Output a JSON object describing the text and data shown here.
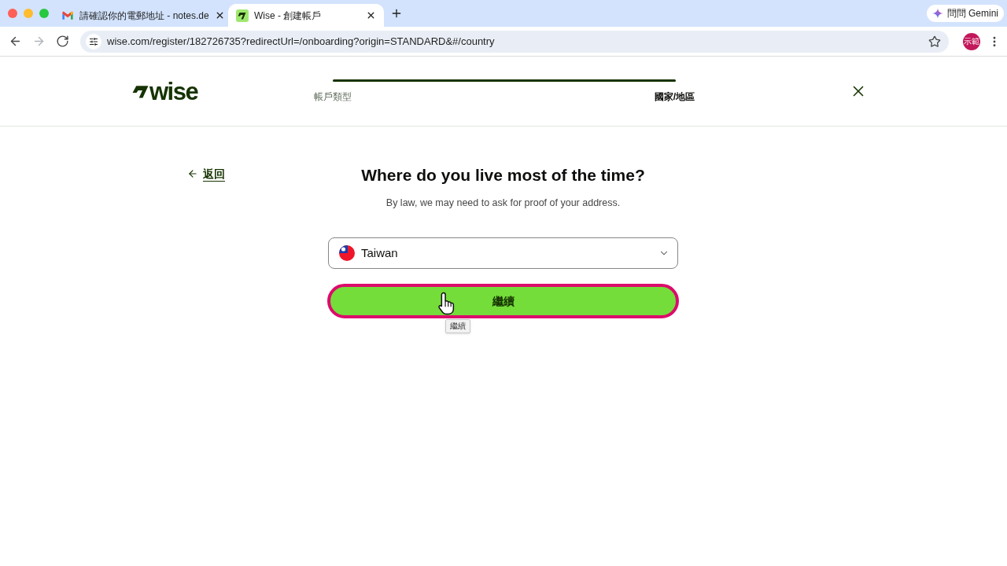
{
  "browser": {
    "tabs": [
      {
        "title": "請確認你的電郵地址 - notes.de",
        "kind": "mail",
        "selected": false
      },
      {
        "title": "Wise - 創建帳戶",
        "kind": "logo",
        "selected": true
      }
    ],
    "gemini_button": "問問 Gemini",
    "nav_buttons": [
      {
        "kind": "back",
        "disabled": false
      },
      {
        "kind": "forward",
        "disabled": true
      },
      {
        "kind": "reload",
        "disabled": false
      }
    ],
    "address": "wise.com/register/182726735?redirectUrl=/onboarding?origin=STANDARD&#/country",
    "profile": "示範"
  },
  "header": {
    "logo": "wise",
    "progress": {
      "level": 1
    },
    "steps": [
      {
        "label": "帳戶類型",
        "selected": false
      },
      {
        "label": "國家/地區",
        "selected": true
      }
    ]
  },
  "form": {
    "back_link": "返回",
    "title": "Where do you live most of the time?",
    "subtitle": "By law, we may need to ask for proof of your address.",
    "country_select": {
      "value": "Taiwan"
    },
    "continue_button": {
      "label": "繼續",
      "highlighted": true
    },
    "tooltip": "繼續"
  }
}
